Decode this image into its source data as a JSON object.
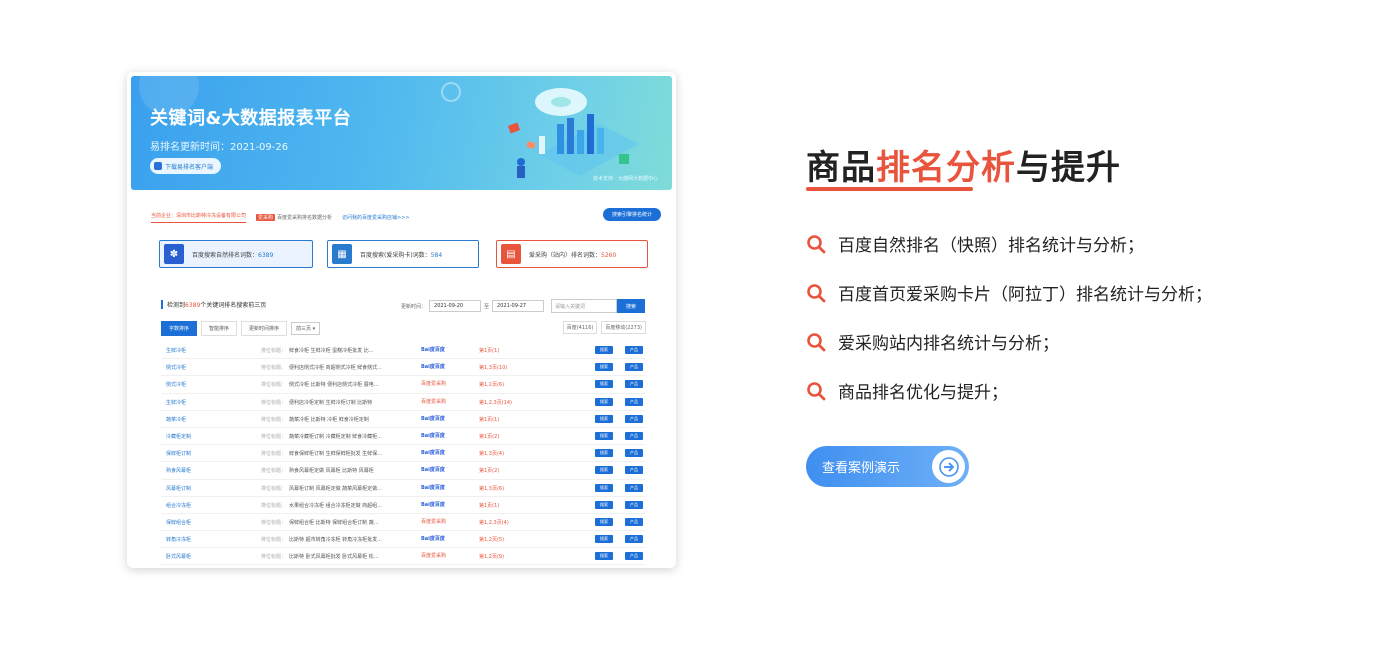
{
  "preview": {
    "banner_title": "关键词&大数据报表平台",
    "banner_updated": "易排名更新时间：2021-09-26",
    "download_client": "下载易排名客户端",
    "credit": "技术支持：大旗网大数据中心",
    "tab_company": "当前企业：深圳市比斯特冷冻设备有限公司",
    "tab_aicaigou_badge": "爱采购",
    "tab_aicaigou": "百度爱采购排名数据分析",
    "tab_visit": "访问我的百度爱采购店铺>>>",
    "tab_stats": "搜索引擎排名统计",
    "stat_natural": {
      "label": "百度搜索自然排名词数：",
      "value": "6389"
    },
    "stat_card": {
      "label": "百度搜索(爱采购卡)词数：",
      "value": "584"
    },
    "stat_station": {
      "label": "爱采购（站内）排名词数：",
      "value": "5260"
    },
    "list_prefix": "检测到",
    "list_count": "6389",
    "list_suffix": "个关键词排名搜索前三页",
    "date_label": "更新时间：",
    "date_from": "2021-09-20",
    "date_sep": "至",
    "date_to": "2021-09-27",
    "search_placeholder": "请输入关键词",
    "search_button": "搜索",
    "sort_tabs": [
      "字数排序",
      "智能排序",
      "更新时间排序"
    ],
    "sort_select": "前三页",
    "engine_tabs": [
      "百度(4116)",
      "百度移动(2273)"
    ],
    "row_label": "排位标题：",
    "btn_search": "搜索",
    "btn_product": "产品",
    "rows": [
      {
        "kw": "生鲜冷柜",
        "title": "鲜食冷柜 生鲜冷柜 蛋糕冷柜批发 比...",
        "engine": "Bai度百度",
        "rank": "第1页(1)"
      },
      {
        "kw": "侧式冷柜",
        "title": "便利店侧式冷柜 商超侧式冷柜 鲜食侧式...",
        "engine": "Bai度百度",
        "rank": "第1,3页(10)"
      },
      {
        "kw": "侧式冷柜",
        "title": "侧式冷柜 比斯特 便利店侧式冷柜 展电...",
        "engine": "百度爱采购",
        "rank": "第1,2页(6)"
      },
      {
        "kw": "生鲜冷柜",
        "title": "便利店冷柜定制 生鲜冷柜订制 比斯特",
        "engine": "百度爱采购",
        "rank": "第1,2,3页(14)"
      },
      {
        "kw": "蔬菜冷柜",
        "title": "蔬菜冷柜 比斯特 冷柜 鲜食冷柜定制",
        "engine": "Bai度百度",
        "rank": "第1页(1)"
      },
      {
        "kw": "冷藏柜定制",
        "title": "蔬菜冷藏柜订制 冷藏柜定制 鲜食冷藏柜...",
        "engine": "Bai度百度",
        "rank": "第1页(2)"
      },
      {
        "kw": "保鲜柜订制",
        "title": "鲜食保鲜柜订制 生鲜保鲜柜批发 生鲜保...",
        "engine": "Bai度百度",
        "rank": "第1,3页(4)"
      },
      {
        "kw": "熟食风幕柜",
        "title": "熟食风幕柜定做 风幕柜 比斯特 风幕柜",
        "engine": "Bai度百度",
        "rank": "第1页(2)"
      },
      {
        "kw": "风幕柜订制",
        "title": "风幕柜订制 风幕柜定做 蔬菜风幕柜定做...",
        "engine": "Bai度百度",
        "rank": "第1,3页(6)"
      },
      {
        "kw": "组合冷冻柜",
        "title": "水果组合冷冻柜 组合冷冻柜定做 商超组...",
        "engine": "Bai度百度",
        "rank": "第1页(1)"
      },
      {
        "kw": "保鲜组合柜",
        "title": "保鲜组合柜 比斯特 保鲜组合柜订制 蔬...",
        "engine": "百度爱采购",
        "rank": "第1,2,3页(4)"
      },
      {
        "kw": "转角冷冻柜",
        "title": "比斯特 超市转角冷冻柜 转角冷冻柜批发...",
        "engine": "Bai度百度",
        "rank": "第1,2页(5)"
      },
      {
        "kw": "卧式风幕柜",
        "title": "比斯特 卧式风幕柜批发 卧式风幕柜 松...",
        "engine": "百度爱采购",
        "rank": "第1,2页(9)"
      }
    ]
  },
  "info": {
    "heading_pre": "商品",
    "heading_hl": "排名分析",
    "heading_post": "与提升",
    "features": [
      "百度自然排名（快照）排名统计与分析；",
      "百度首页爱采购卡片（阿拉丁）排名统计与分析；",
      "爱采购站内排名统计与分析；",
      "商品排名优化与提升；"
    ],
    "cta_label": "查看案例演示"
  },
  "colors": {
    "accent": "#e8543c",
    "primary": "#1c6fd6",
    "cta": "#4a96f2"
  }
}
